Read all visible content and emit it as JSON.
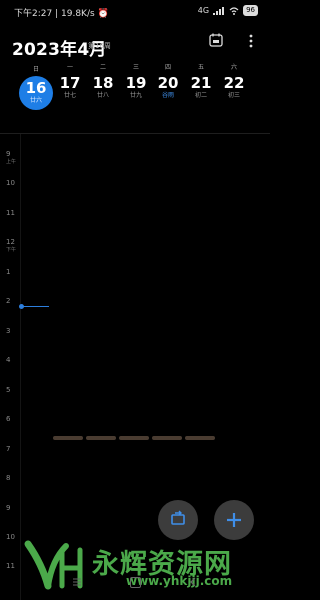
{
  "status_bar": {
    "time": "下午2:27",
    "speed": "19.8K/s",
    "signal": "4G",
    "battery": "96"
  },
  "header": {
    "title": "2023年4月",
    "week_badge": "第16周"
  },
  "week": {
    "days": [
      {
        "dow": "日",
        "num": "16",
        "lunar": "廿六",
        "today": true
      },
      {
        "dow": "一",
        "num": "17",
        "lunar": "廿七"
      },
      {
        "dow": "二",
        "num": "18",
        "lunar": "廿八"
      },
      {
        "dow": "三",
        "num": "19",
        "lunar": "廿九"
      },
      {
        "dow": "四",
        "num": "20",
        "lunar": "谷雨"
      },
      {
        "dow": "五",
        "num": "21",
        "lunar": "初二"
      },
      {
        "dow": "六",
        "num": "22",
        "lunar": "初三"
      }
    ]
  },
  "hours": [
    {
      "label": "9",
      "ampm": "上午"
    },
    {
      "label": "10"
    },
    {
      "label": "11"
    },
    {
      "label": "12",
      "ampm": "下午"
    },
    {
      "label": "1"
    },
    {
      "label": "2"
    },
    {
      "label": "3"
    },
    {
      "label": "4"
    },
    {
      "label": "5"
    },
    {
      "label": "6"
    },
    {
      "label": "7"
    },
    {
      "label": "8"
    },
    {
      "label": "9"
    },
    {
      "label": "10"
    },
    {
      "label": "11"
    }
  ],
  "colors": {
    "accent": "#1e7ee6",
    "event_bar": "#4a3c31",
    "watermark": "#4ba94a"
  },
  "fab": {
    "swap_icon": "swap-icon",
    "add_icon": "plus-icon"
  },
  "watermark": {
    "brand": "永辉资源网",
    "url": "www.yhkjjj.com"
  }
}
